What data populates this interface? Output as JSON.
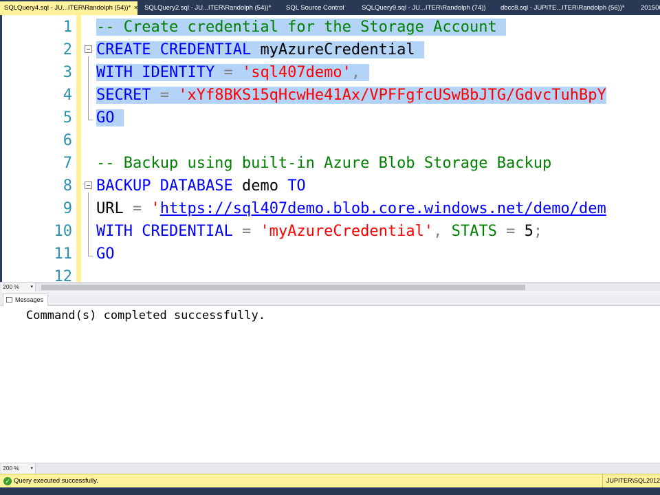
{
  "tabs": [
    {
      "label": "SQLQuery4.sql - JU...ITER\\Randolph (54))*",
      "active": true
    },
    {
      "label": "SQLQuery2.sql - JU...ITER\\Randolph (54))*",
      "active": false
    },
    {
      "label": "SQL Source Control",
      "active": false
    },
    {
      "label": "SQLQuery9.sql - JU...ITER\\Randolph (74))",
      "active": false
    },
    {
      "label": "dbcc8.sql - JUPITE...ITER\\Randolph (56))*",
      "active": false
    },
    {
      "label": "201506",
      "active": false
    }
  ],
  "tab_close_glyph": "×",
  "editor": {
    "line_numbers": [
      "1",
      "2",
      "3",
      "4",
      "5",
      "6",
      "7",
      "8",
      "9",
      "10",
      "11",
      "12"
    ],
    "line1": {
      "comment": "-- Create credential for the Storage Account"
    },
    "line2": {
      "kw1": "CREATE",
      "kw2": "CREDENTIAL",
      "name": "myAzureCredential"
    },
    "line3": {
      "kw1": "WITH",
      "kw2": "IDENTITY",
      "eq": "=",
      "str": "'sql407demo'",
      "comma": ","
    },
    "line4": {
      "kw1": "SECRET",
      "eq": "=",
      "str": "'xYf8BKS15qHcwHe41Ax/VPFFgfcUSwBbJTG/GdvcTuhBpY"
    },
    "line5": {
      "kw1": "GO"
    },
    "line7": {
      "comment": "-- Backup using built-in Azure Blob Storage Backup"
    },
    "line8": {
      "kw1": "BACKUP",
      "kw2": "DATABASE",
      "name": "demo",
      "kw3": "TO"
    },
    "line9": {
      "kw1": "URL",
      "eq": "=",
      "quote": "'",
      "url": "https://sql407demo.blob.core.windows.net/demo/dem"
    },
    "line10": {
      "kw1": "WITH",
      "kw2": "CREDENTIAL",
      "eq": "=",
      "str": "'myAzureCredential'",
      "comma": ",",
      "kw3": "STATS",
      "eq2": "=",
      "num": "5",
      "semi": ";"
    },
    "line11": {
      "kw1": "GO"
    }
  },
  "editor_zoom": "200 %",
  "results_zoom": "200 %",
  "dropdown_glyph": "▾",
  "messages_tab": {
    "label": "Messages"
  },
  "messages": {
    "text": "Command(s) completed successfully."
  },
  "status": {
    "text": "Query executed successfully.",
    "server": "JUPITER\\SQL2012",
    "icon_glyph": "✓"
  },
  "colors": {
    "tabbar": "#293955",
    "active_tab": "#fff29d",
    "selection": "#b3d3f7",
    "keyword": "#0000ff",
    "comment": "#008000",
    "string": "#ff0000",
    "line_number": "#2b91af",
    "status_bar": "#fff29d"
  }
}
